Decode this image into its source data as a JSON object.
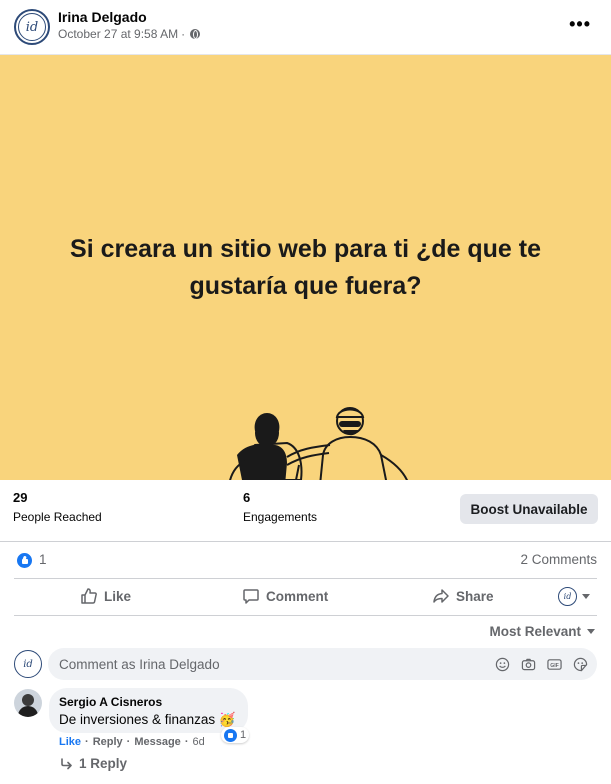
{
  "post": {
    "author": "Irina Delgado",
    "avatar_initials": "id",
    "timestamp": "October 27 at 9:58 AM",
    "separator": "·",
    "privacy_icon": "globe-icon",
    "more_label": "•••"
  },
  "image": {
    "background": "#f9d47c",
    "text_line1": "Si creara un sitio web para ti ¿de que te",
    "text_line2": "gustaría que fuera?"
  },
  "insights": {
    "reach_value": "29",
    "reach_label": "People Reached",
    "engage_value": "6",
    "engage_label": "Engagements",
    "boost_label": "Boost Unavailable"
  },
  "reactions": {
    "like_count": "1",
    "comments": "2 Comments"
  },
  "actions": {
    "like": "Like",
    "comment": "Comment",
    "share": "Share"
  },
  "comments": {
    "sort_label": "Most Relevant",
    "composer_placeholder": "Comment as Irina Delgado",
    "items": [
      {
        "name": "Sergio A Cisneros",
        "text": "De inversiones & finanzas 🥳",
        "reaction_count": "1",
        "like": "Like",
        "reply": "Reply",
        "message": "Message",
        "time": "6d",
        "replies": "1 Reply"
      }
    ]
  },
  "colors": {
    "accent": "#1877f2",
    "muted": "#65676b",
    "avatar_ring": "#2d4a78"
  }
}
